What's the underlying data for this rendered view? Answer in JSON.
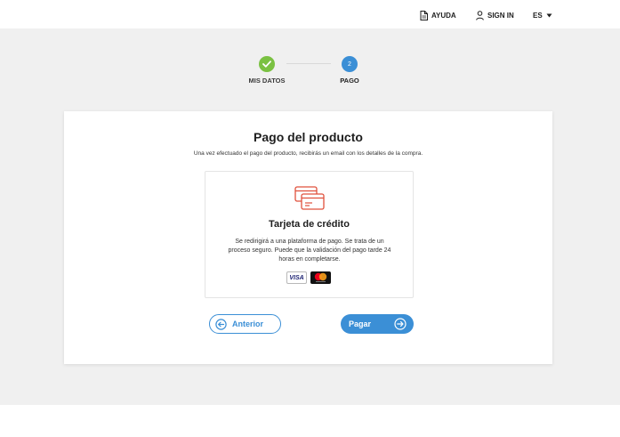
{
  "header": {
    "help_label": "AYUDA",
    "signin_label": "SIGN IN",
    "lang_label": "ES"
  },
  "stepper": {
    "steps": [
      {
        "label": "MIS DATOS",
        "state": "completed"
      },
      {
        "label": "PAGO",
        "number": "2",
        "state": "active"
      }
    ]
  },
  "payment": {
    "title": "Pago del producto",
    "subtitle": "Una vez efectuado el pago del producto, recibirás un email con los detalles de la compra.",
    "method": {
      "title": "Tarjeta de crédito",
      "description": "Se redirigirá a una plataforma de pago. Se trata de un proceso seguro. Puede que la validación del pago tarde 24 horas en completarse.",
      "brands": [
        "VISA",
        "Mastercard"
      ]
    }
  },
  "actions": {
    "prev_label": "Anterior",
    "next_label": "Pagar"
  },
  "colors": {
    "accent": "#3b8fd6",
    "success": "#7ac142",
    "card_icon": "#e0503c",
    "background": "#f0f0f0"
  }
}
